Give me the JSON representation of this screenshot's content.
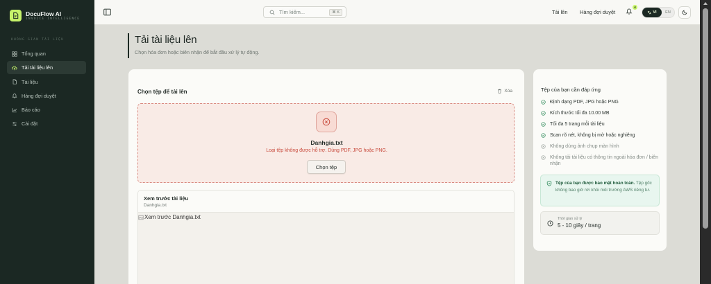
{
  "app": {
    "name": "DocuFlow AI",
    "tagline": "INVOICE INTELLIGENCE"
  },
  "sidebar": {
    "section_label": "KHÔNG GIAN TÀI LIỆU",
    "items": [
      {
        "label": "Tổng quan",
        "icon": "grid-icon",
        "active": false
      },
      {
        "label": "Tải tài liệu lên",
        "icon": "upload-cloud-icon",
        "active": true
      },
      {
        "label": "Tài liệu",
        "icon": "document-icon",
        "active": false
      },
      {
        "label": "Hàng đợi duyệt",
        "icon": "bell-icon",
        "active": false
      },
      {
        "label": "Báo cáo",
        "icon": "chart-icon",
        "active": false
      },
      {
        "label": "Cài đặt",
        "icon": "sliders-icon",
        "active": false
      }
    ]
  },
  "topbar": {
    "search_placeholder": "Tìm kiếm...",
    "search_shortcut": "⌘ K",
    "links": [
      "Tải lên",
      "Hàng đợi duyệt"
    ],
    "notification_count": "4",
    "lang_active": "VI",
    "lang_other": "EN"
  },
  "page": {
    "title": "Tải tài liệu lên",
    "subtitle": "Chọn hóa đơn hoặc biên nhận để bắt đầu xử lý tự động."
  },
  "upload": {
    "heading": "Chọn tệp để tải lên",
    "clear_label": "Xóa",
    "file_name": "Danhgia.txt",
    "error_message": "Loại tệp không được hỗ trợ. Dùng PDF, JPG hoặc PNG.",
    "choose_label": "Chọn tệp"
  },
  "preview": {
    "title": "Xem trước tài liệu",
    "file_name": "Danhgia.txt",
    "broken_image_alt": "Xem trước Danhgia.txt"
  },
  "requirements": {
    "title": "Tệp của bạn cần đáp ứng",
    "items": [
      {
        "text": "Định dạng PDF, JPG hoặc PNG",
        "ok": true
      },
      {
        "text": "Kích thước tối đa 10.00 MB",
        "ok": true
      },
      {
        "text": "Tối đa 5 trang mỗi tài liệu",
        "ok": true
      },
      {
        "text": "Scan rõ nét, không bị mờ hoặc nghiêng",
        "ok": true
      },
      {
        "text": "Không dùng ảnh chụp màn hình",
        "ok": false
      },
      {
        "text": "Không tải tài liệu có thông tin ngoài hóa đơn / biên nhận",
        "ok": false
      }
    ],
    "security_strong": "Tệp của bạn được bảo mật hoàn toàn.",
    "security_text": " Tệp gốc không bao giờ rời khỏi môi trường AWS riêng tư.",
    "time_label": "Thời gian xử lý",
    "time_value": "5 - 10 giây / trang"
  },
  "colors": {
    "sidebar_bg": "#1b2823",
    "accent": "#c6f36a",
    "error": "#c8493b",
    "success": "#2f8a5a"
  }
}
